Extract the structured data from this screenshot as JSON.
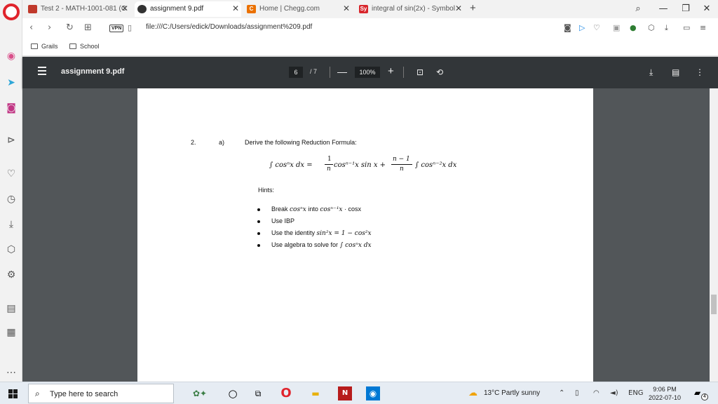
{
  "tabs": [
    {
      "title": "Test 2 - MATH-1001-081 (C",
      "fav": "",
      "color": "#c0392b",
      "active": false
    },
    {
      "title": "assignment 9.pdf",
      "fav": "",
      "color": "#333333",
      "active": true
    },
    {
      "title": "Home | Chegg.com",
      "fav": "C",
      "color": "#eb7100",
      "active": false
    },
    {
      "title": "integral of sin(2x) - Symbol",
      "fav": "Sy",
      "color": "#d8272d",
      "active": false
    }
  ],
  "address": {
    "vpn": "VPN",
    "url": "file:///C:/Users/edick/Downloads/assignment%209.pdf"
  },
  "bookmarks": [
    "Grails",
    "School"
  ],
  "pdf": {
    "title": "assignment 9.pdf",
    "page": "6",
    "total": "/ 7",
    "zoom": "100%"
  },
  "doc": {
    "number": "2.",
    "part": "a)",
    "instruction": "Derive the following Reduction Formula:",
    "formula": {
      "lhs": "∫ cosⁿx dx  =",
      "frac1_num": "1",
      "frac1_den": "n",
      "mid": "cosⁿ⁻¹x  sin x +",
      "frac2_num": "n − 1",
      "frac2_den": "n",
      "rhs": "∫ cosⁿ⁻²x dx"
    },
    "hints_label": "Hints:",
    "hints": [
      {
        "text": "Break ",
        "math": "cosⁿx",
        "text2": " into ",
        "math2": "cosⁿ⁻¹x",
        "text3": " · cosx"
      },
      {
        "text": "Use IBP",
        "math": "",
        "text2": "",
        "math2": "",
        "text3": ""
      },
      {
        "text": "Use the identity ",
        "math": "sin²x = 1 − cos²x",
        "text2": "",
        "math2": "",
        "text3": ""
      },
      {
        "text": "Use algebra to solve for ",
        "math": "∫ cosⁿx dx",
        "text2": "",
        "math2": "",
        "text3": ""
      }
    ]
  },
  "taskbar": {
    "search_placeholder": "Type here to search",
    "weather": "13°C  Partly sunny",
    "lang": "ENG",
    "time": "9:06 PM",
    "date": "2022-07-10",
    "notifications": "4"
  }
}
